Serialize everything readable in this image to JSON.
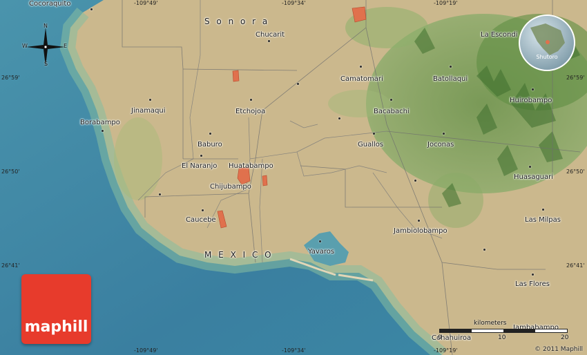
{
  "map": {
    "colors": {
      "sea_deep": "#3f86a6",
      "sea_shallow": "#7fb7a3",
      "land": "#c9b68c",
      "vegetation": "#6f9e4e",
      "mountains": "#4d7f3a",
      "urban": "#e0714d",
      "roads": "#6b6b6b"
    },
    "places": [
      {
        "name": "Cocoraquito"
      },
      {
        "name": "Chucarit"
      },
      {
        "name": "La Escondi"
      },
      {
        "name": "Camatomari"
      },
      {
        "name": "Batollaqui"
      },
      {
        "name": "Jinamaqui"
      },
      {
        "name": "Etchojoa"
      },
      {
        "name": "Bacabachi"
      },
      {
        "name": "Huirobampo"
      },
      {
        "name": "Borabampo"
      },
      {
        "name": "Baburo"
      },
      {
        "name": "Guallos"
      },
      {
        "name": "Joconas"
      },
      {
        "name": "El Naranjo"
      },
      {
        "name": "Huatabampo"
      },
      {
        "name": "Huasaguari"
      },
      {
        "name": "Chijubampo"
      },
      {
        "name": "Caucebe"
      },
      {
        "name": "Jambiolobampo"
      },
      {
        "name": "Las Milpas"
      },
      {
        "name": "Yavaros"
      },
      {
        "name": "Las Flores"
      },
      {
        "name": "Cohahuiroa"
      },
      {
        "name": "Jambabampo"
      }
    ],
    "regions": [
      {
        "name": "S o n o r a"
      },
      {
        "name": "M E X I C O"
      }
    ],
    "coordinates": {
      "top": [
        "-109°49'",
        "-109°34'",
        "-109°19'"
      ],
      "bottom": [
        "-109°49'",
        "-109°34'",
        "-109°19'"
      ],
      "left": [
        "26°59'",
        "26°50'",
        "26°41'"
      ],
      "right": [
        "26°59'",
        "26°50'",
        "26°41'"
      ]
    },
    "compass": {
      "n": "N",
      "s": "S",
      "e": "E",
      "w": "W"
    },
    "globe_label": "Shutoro",
    "logo": "maphill",
    "scale": {
      "unit": "kilometers",
      "ticks": [
        "0",
        "10",
        "20"
      ]
    },
    "copyright": "© 2011 Maphill"
  }
}
